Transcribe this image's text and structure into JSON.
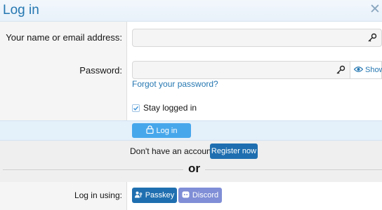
{
  "dialog": {
    "title": "Log in",
    "close_icon": "close-icon"
  },
  "form": {
    "username_label": "Your name or email address:",
    "username_value": "",
    "password_label": "Password:",
    "password_value": "",
    "show_label": "Show",
    "forgot_link": "Forgot your password?",
    "stay_logged_in_label": "Stay logged in",
    "stay_logged_in_checked": true,
    "submit_label": "Log in"
  },
  "register": {
    "prompt": "Don't have an account?",
    "button_label": "Register now",
    "or_text": "or"
  },
  "login_using": {
    "label": "Log in using:",
    "providers": [
      {
        "label": "Passkey",
        "icon": "passkey-icon",
        "color": "#1f6fb0"
      },
      {
        "label": "Discord",
        "icon": "discord-icon",
        "color": "#7f8ed6"
      }
    ]
  },
  "colors": {
    "accent": "#2577b1",
    "primary_button": "#47a7eb",
    "dark_button": "#1f6fb0"
  }
}
